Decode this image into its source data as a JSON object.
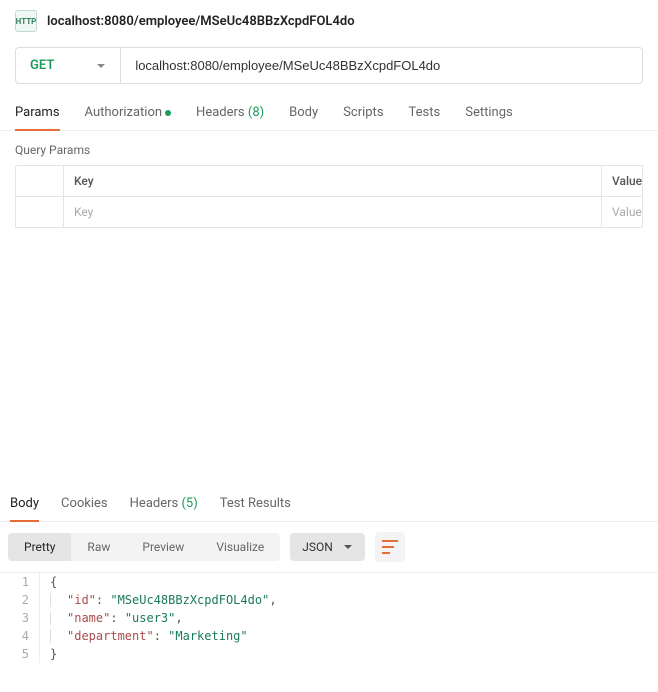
{
  "header": {
    "badge": "HTTP",
    "title": "localhost:8080/employee/MSeUc48BBzXcpdFOL4do"
  },
  "request": {
    "method": "GET",
    "url": "localhost:8080/employee/MSeUc48BBzXcpdFOL4do"
  },
  "reqTabs": {
    "params": "Params",
    "auth": "Authorization",
    "headers_label": "Headers",
    "headers_count": "(8)",
    "body": "Body",
    "scripts": "Scripts",
    "tests": "Tests",
    "settings": "Settings"
  },
  "queryParams": {
    "section": "Query Params",
    "keyHeader": "Key",
    "valueHeader": "Value",
    "keyPlaceholder": "Key",
    "valuePlaceholder": "Value"
  },
  "respTabs": {
    "body": "Body",
    "cookies": "Cookies",
    "headers_label": "Headers",
    "headers_count": "(5)",
    "testResults": "Test Results"
  },
  "respToolbar": {
    "pretty": "Pretty",
    "raw": "Raw",
    "preview": "Preview",
    "visualize": "Visualize",
    "format": "JSON"
  },
  "responseBody": {
    "l1_num": "1",
    "l1": "{",
    "l2_num": "2",
    "l2_key": "\"id\"",
    "l2_val": "\"MSeUc48BBzXcpdFOL4do\"",
    "l3_num": "3",
    "l3_key": "\"name\"",
    "l3_val": "\"user3\"",
    "l4_num": "4",
    "l4_key": "\"department\"",
    "l4_val": "\"Marketing\"",
    "l5_num": "5",
    "l5": "}"
  }
}
